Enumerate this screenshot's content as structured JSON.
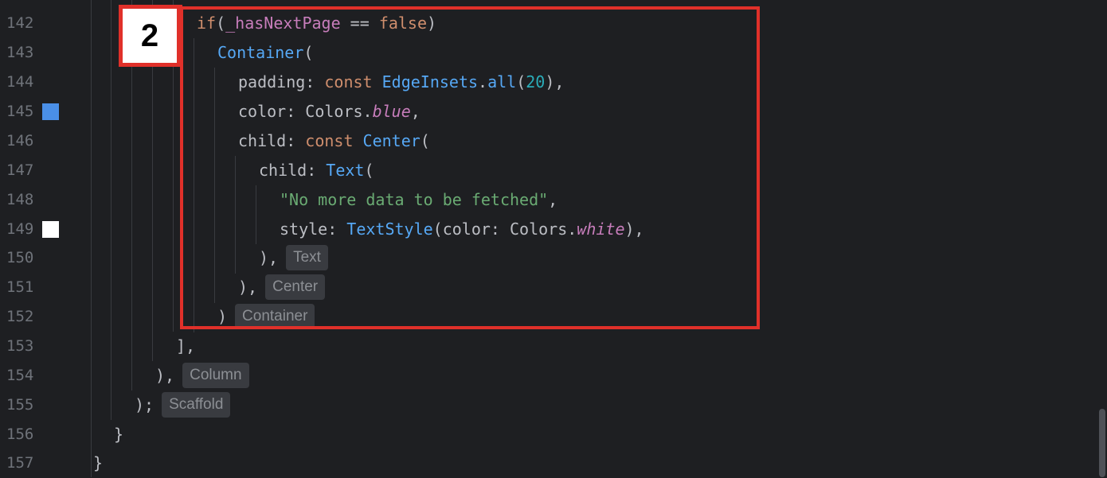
{
  "gutter": {
    "lines": [
      "142",
      "143",
      "144",
      "145",
      "146",
      "147",
      "148",
      "149",
      "150",
      "151",
      "152",
      "153",
      "154",
      "155",
      "156",
      "157"
    ],
    "swatches": {
      "line_145": "#4a8fe7",
      "line_149": "#ffffff"
    }
  },
  "annotation": {
    "badge_number": "2",
    "box_color": "#e0302a"
  },
  "code": {
    "l142": {
      "kw": "if",
      "open": "(",
      "field": "_hasNextPage",
      "op": " == ",
      "kw2": "false",
      "close": ")"
    },
    "l143": {
      "cls": "Container",
      "open": "("
    },
    "l144": {
      "prop": "padding: ",
      "kw": "const ",
      "cls": "EdgeInsets",
      "dot": ".",
      "fn": "all",
      "open": "(",
      "num": "20",
      "close": "),"
    },
    "l145": {
      "prop": "color: ",
      "cls": "Colors.",
      "it": "blue",
      "close": ","
    },
    "l146": {
      "prop": "child: ",
      "kw": "const ",
      "cls": "Center",
      "open": "("
    },
    "l147": {
      "prop": "child: ",
      "cls": "Text",
      "open": "("
    },
    "l148": {
      "str": "\"No more data to be fetched\"",
      "close": ","
    },
    "l149": {
      "prop": "style: ",
      "cls": "TextStyle",
      "mid": "(color: Colors.",
      "it": "white",
      "close": "),"
    },
    "l150": {
      "close": "),",
      "hint": "Text"
    },
    "l151": {
      "close": "),",
      "hint": "Center"
    },
    "l152": {
      "close": ")",
      "hint": "Container"
    },
    "l153": {
      "close": "],"
    },
    "l154": {
      "close": "),",
      "hint": "Column"
    },
    "l155": {
      "close": ");",
      "hint": "Scaffold"
    },
    "l156": {
      "close": "}"
    },
    "l157": {
      "close": "}"
    }
  }
}
